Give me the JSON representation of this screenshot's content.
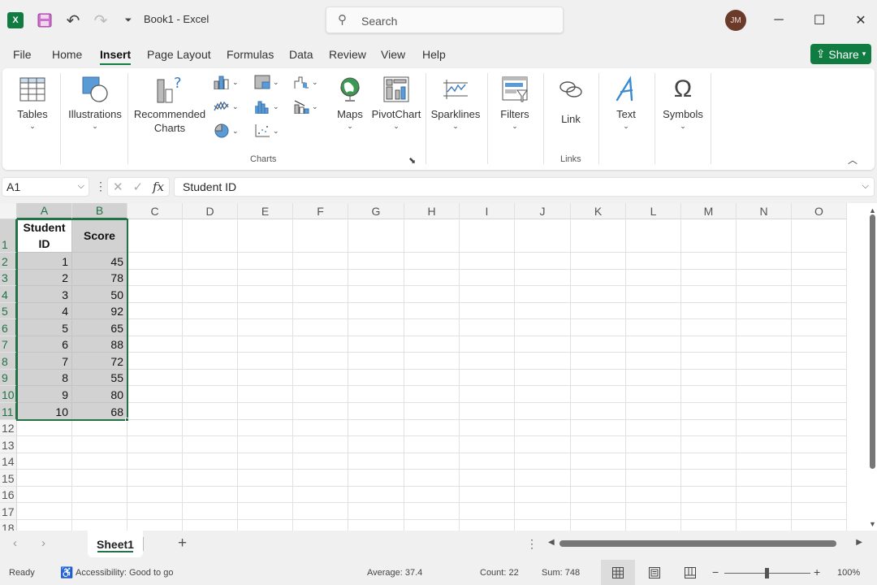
{
  "titlebar": {
    "app_icon": "excel-logo-icon",
    "app_icon_text": "X",
    "save_icon": "save-icon",
    "undo_icon": "undo-icon",
    "redo_icon": "redo-icon",
    "customize_icon": "customize-qat-icon",
    "doc_title": "Book1  -  Excel",
    "search_placeholder": "Search",
    "avatar_initials": "JM",
    "minimize": "─",
    "maximize": "☐",
    "close": "✕"
  },
  "menu": {
    "items": [
      "File",
      "Home",
      "Insert",
      "Page Layout",
      "Formulas",
      "Data",
      "Review",
      "View",
      "Help"
    ],
    "active": "Insert",
    "share_label": "Share"
  },
  "ribbon": {
    "tables": "Tables",
    "illustrations": "Illustrations",
    "recommended_charts_1": "Recommended",
    "recommended_charts_2": "Charts",
    "maps": "Maps",
    "pivotchart": "PivotChart",
    "charts_group": "Charts",
    "sparklines": "Sparklines",
    "filters": "Filters",
    "link": "Link",
    "links_group": "Links",
    "text": "Text",
    "symbols": "Symbols",
    "chevron": "⌄"
  },
  "formula_bar": {
    "name_box": "A1",
    "formula": "Student ID",
    "cancel": "✕",
    "enter": "✓",
    "fx": "fx"
  },
  "sheet": {
    "columns": [
      "A",
      "B",
      "C",
      "D",
      "E",
      "F",
      "G",
      "H",
      "I",
      "J",
      "K",
      "L",
      "M",
      "N",
      "O"
    ],
    "rows": [
      "1",
      "2",
      "3",
      "4",
      "5",
      "6",
      "7",
      "8",
      "9",
      "10",
      "11",
      "12",
      "13",
      "14",
      "15",
      "16",
      "17",
      "18"
    ],
    "headers": [
      "Student ID",
      "Score"
    ],
    "data": [
      [
        1,
        45
      ],
      [
        2,
        78
      ],
      [
        3,
        50
      ],
      [
        4,
        92
      ],
      [
        5,
        65
      ],
      [
        6,
        88
      ],
      [
        7,
        72
      ],
      [
        8,
        55
      ],
      [
        9,
        80
      ],
      [
        10,
        68
      ]
    ],
    "selection": "A1:B11"
  },
  "sheet_tabs": {
    "tabs": [
      "Sheet1"
    ],
    "active": "Sheet1",
    "add": "+",
    "prev": "‹",
    "next": "›"
  },
  "status": {
    "ready": "Ready",
    "accessibility": "Accessibility: Good to go",
    "average": "Average: 37.4",
    "count": "Count: 22",
    "sum": "Sum: 748",
    "zoom": "100%",
    "zoom_minus": "−",
    "zoom_plus": "+",
    "zoom_level_percent": 100
  },
  "colors": {
    "accent": "#107c41",
    "selection_border": "#217346",
    "selection_fill": "#d2d2d2"
  }
}
